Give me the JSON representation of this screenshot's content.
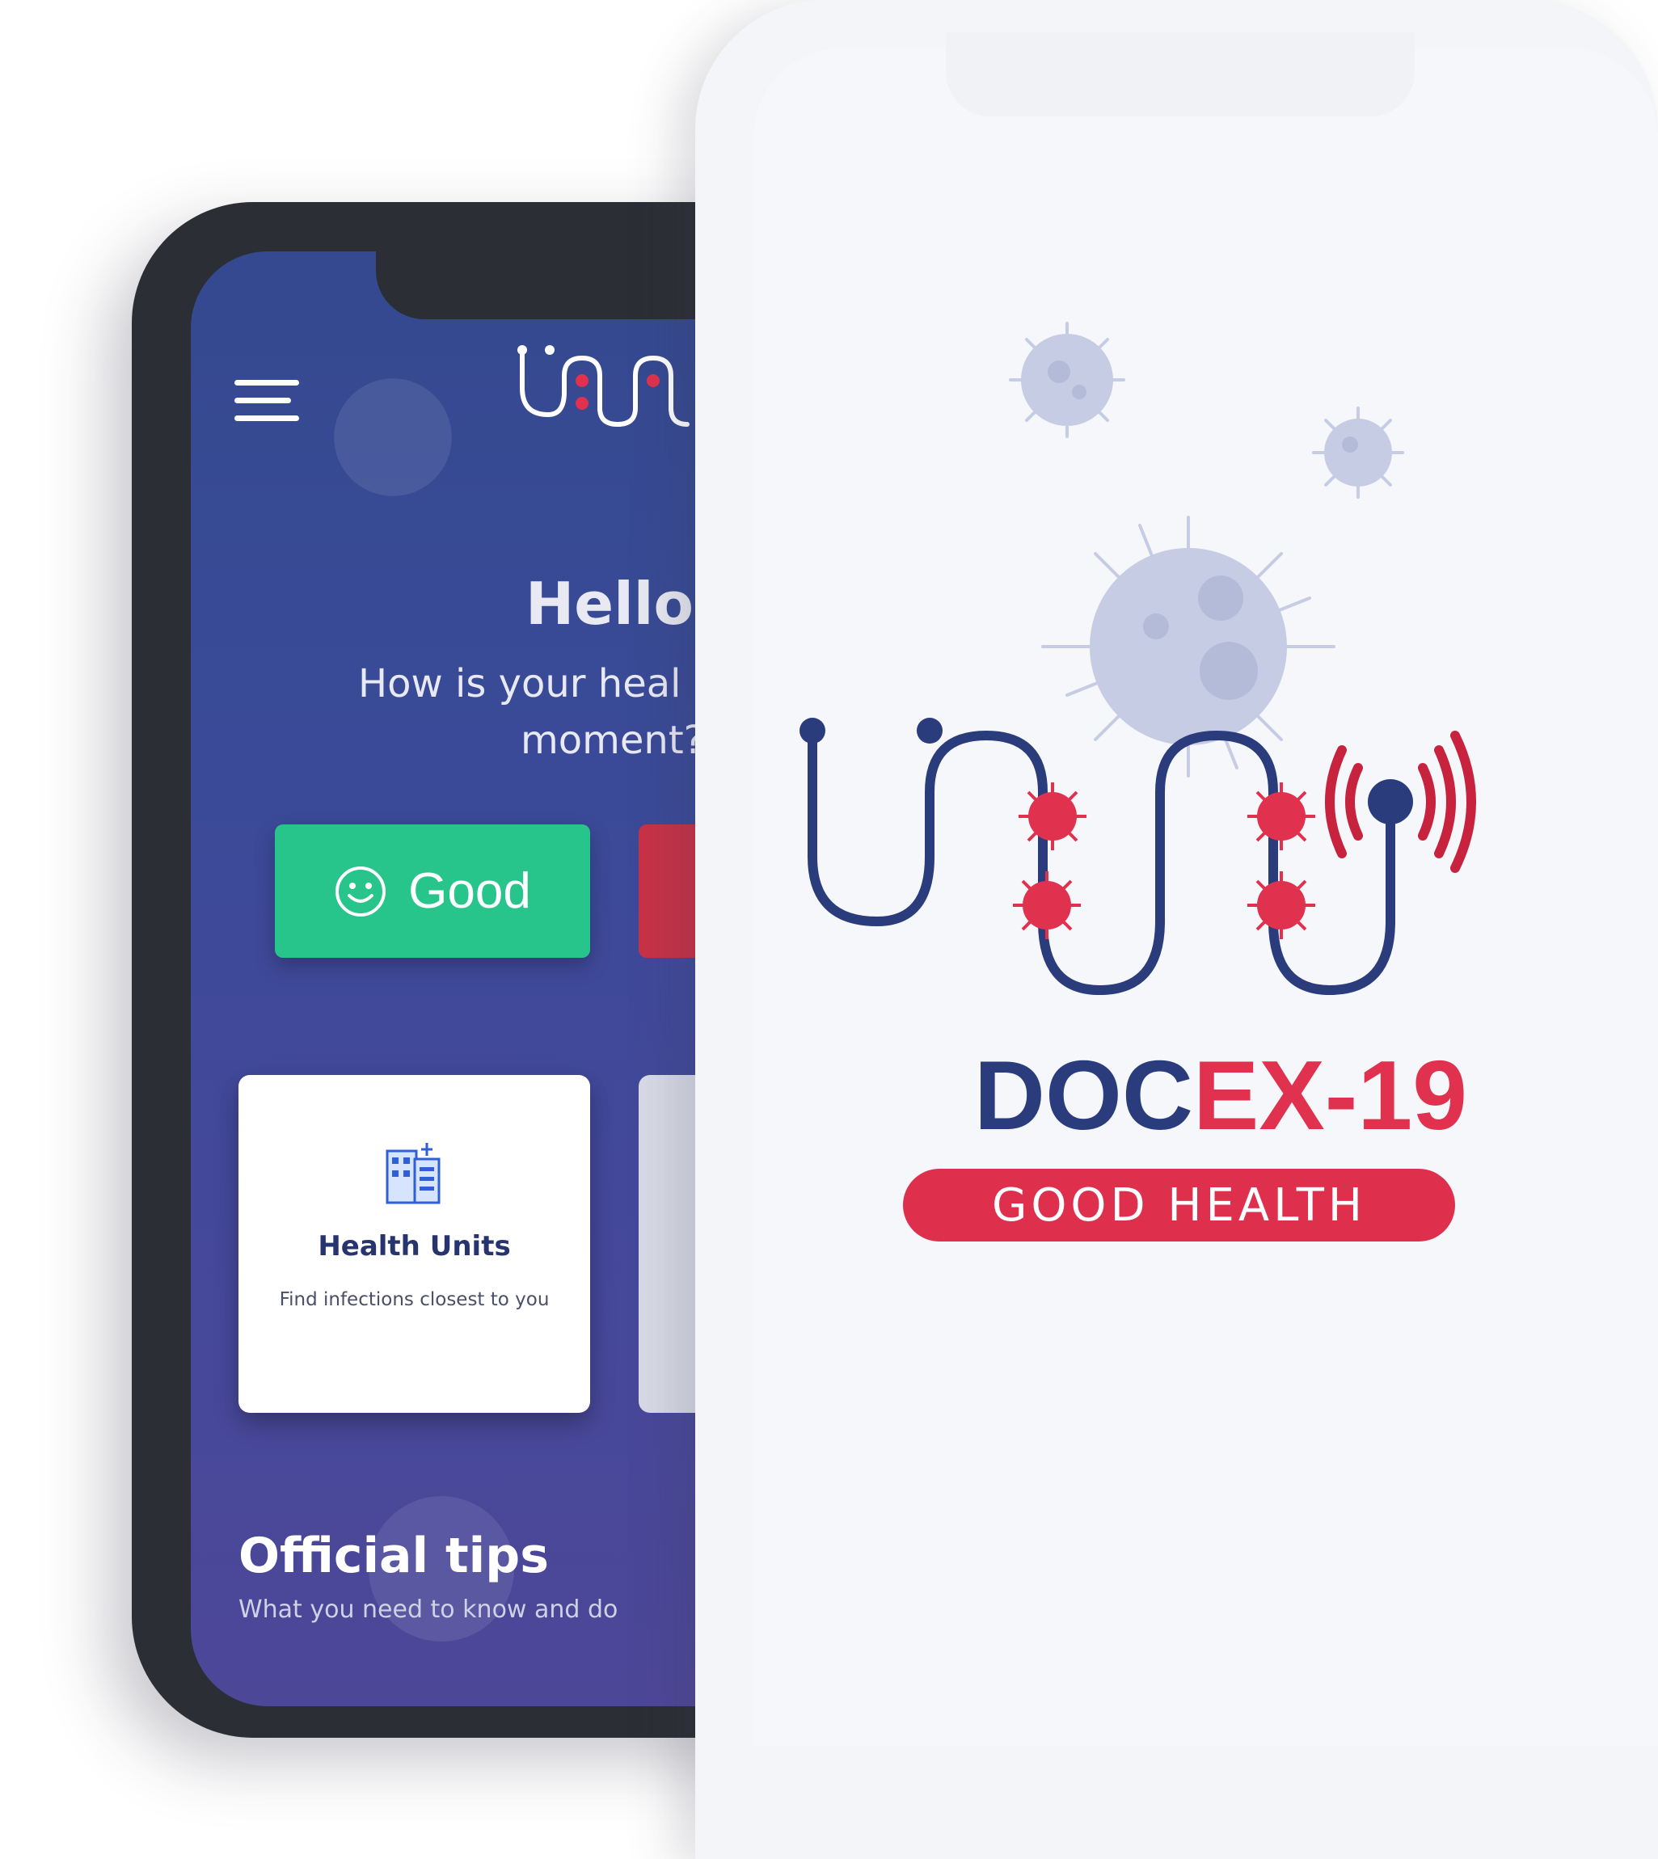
{
  "back_phone": {
    "greeting": "Hello,",
    "question_line_1": "How is your heal",
    "question_line_2": "moment?",
    "good_button_label": "Good",
    "health_card": {
      "title": "Health Units",
      "description": "Find infections closest to you"
    },
    "tips": {
      "title": "Official tips",
      "subtitle": "What you need to know and do"
    }
  },
  "front_phone": {
    "brand_part_1": "DOC",
    "brand_part_2": "EX-19",
    "tagline": "GOOD HEALTH"
  },
  "colors": {
    "brand_navy": "#2a3c7c",
    "brand_red": "#e0324f",
    "good_green": "#27c58c",
    "bad_red": "#c83247",
    "app_blue": "#3a4a98"
  },
  "icons": [
    "menu-icon",
    "smiley-icon",
    "hospital-buildings-icon",
    "stethoscope-logo-icon",
    "virus-icon",
    "signal-waves-icon"
  ]
}
